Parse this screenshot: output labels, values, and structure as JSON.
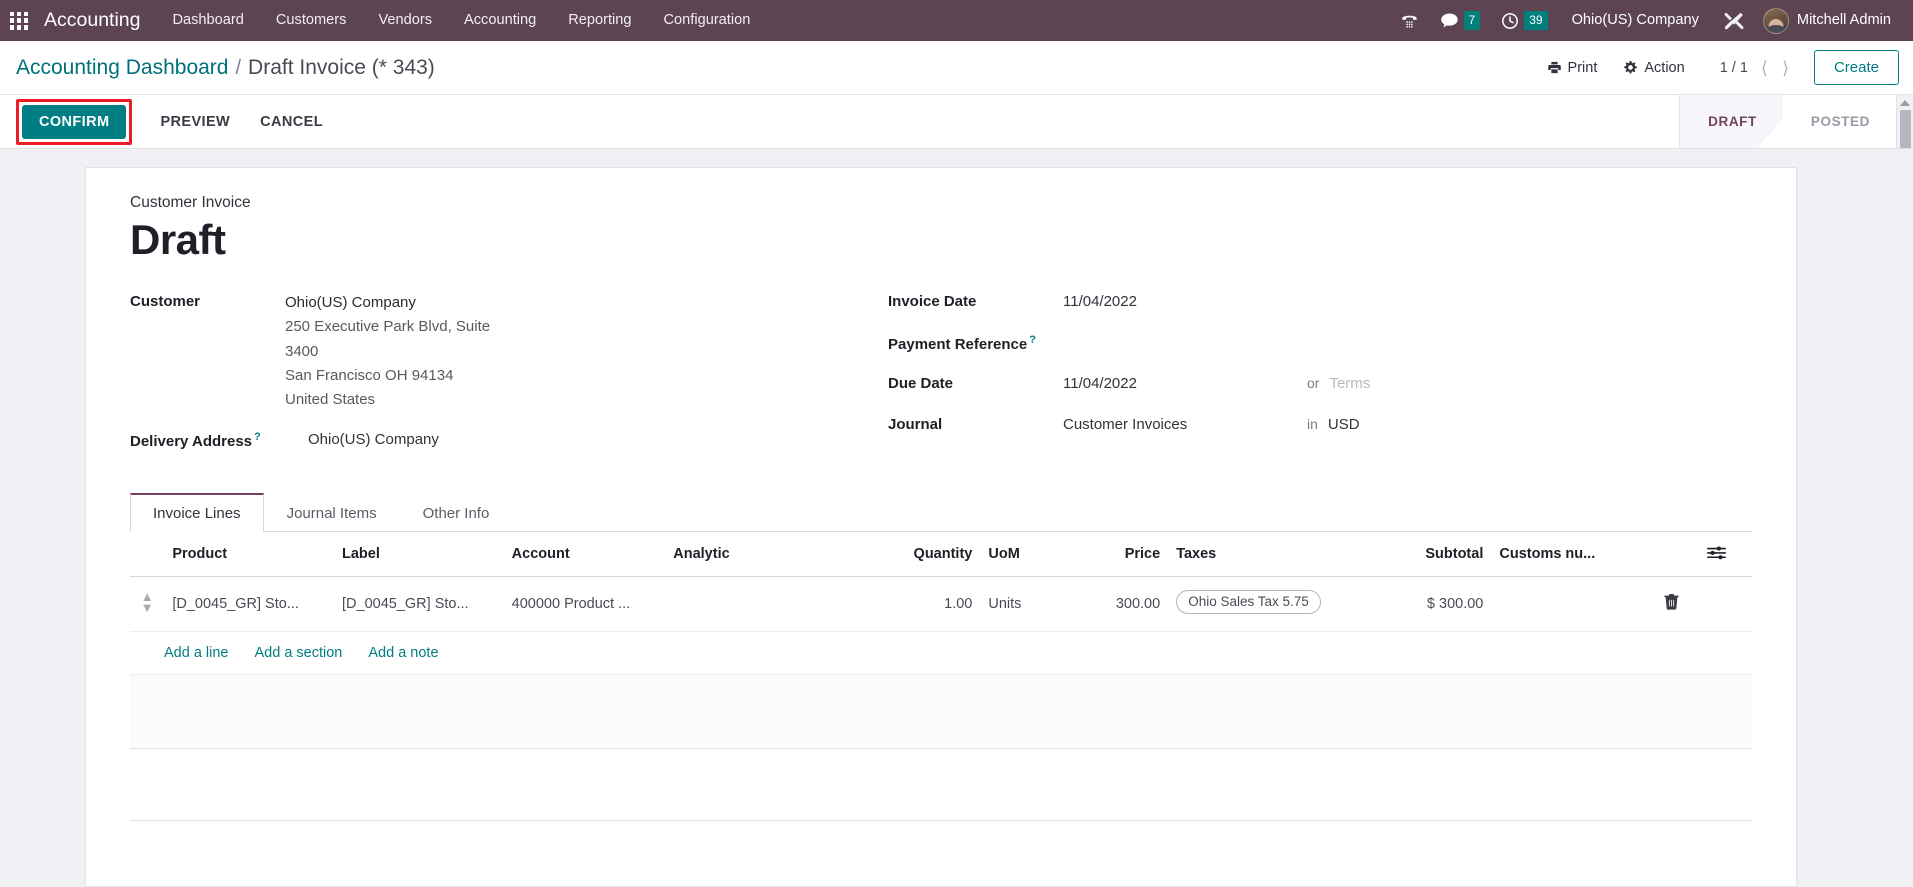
{
  "navbar": {
    "apps_icon": "apps-grid-icon",
    "brand": "Accounting",
    "menu": [
      {
        "label": "Dashboard"
      },
      {
        "label": "Customers"
      },
      {
        "label": "Vendors"
      },
      {
        "label": "Accounting"
      },
      {
        "label": "Reporting"
      },
      {
        "label": "Configuration"
      }
    ],
    "systray": {
      "voip_icon": "phone-dialpad-icon",
      "messages_icon": "chat-bubble-icon",
      "messages_count": "7",
      "activities_icon": "clock-icon",
      "activities_count": "39",
      "company": "Ohio(US) Company",
      "debug_icon": "tools-icon",
      "avatar": "user-avatar",
      "user": "Mitchell Admin"
    },
    "background_color": "#5c4452",
    "badge_color": "#00807b"
  },
  "control_panel": {
    "breadcrumb": {
      "root": "Accounting Dashboard",
      "separator": "/",
      "current": "Draft Invoice (* 343)"
    },
    "print_label": "Print",
    "print_icon": "printer-icon",
    "action_label": "Action",
    "action_icon": "gear-icon",
    "pager": "1 / 1",
    "prev_icon": "chevron-left-icon",
    "next_icon": "chevron-right-icon",
    "create_label": "Create",
    "buttons": {
      "confirm": "CONFIRM",
      "preview": "PREVIEW",
      "cancel": "CANCEL"
    },
    "highlight_color": "#ee1c24",
    "accent_color": "#017e84",
    "statusbar": [
      {
        "label": "DRAFT",
        "active": true
      },
      {
        "label": "POSTED",
        "active": false
      }
    ]
  },
  "form": {
    "doc_type": "Customer Invoice",
    "title": "Draft",
    "left": {
      "customer_label": "Customer",
      "customer_name": "Ohio(US) Company",
      "customer_address": [
        "250 Executive Park Blvd, Suite",
        "3400",
        "San Francisco OH 94134",
        "United States"
      ],
      "delivery_address_label": "Delivery Address",
      "delivery_address_tip": "?",
      "delivery_address_value": "Ohio(US) Company"
    },
    "right": {
      "invoice_date_label": "Invoice Date",
      "invoice_date_value": "11/04/2022",
      "payment_reference_label": "Payment Reference",
      "payment_reference_tip": "?",
      "payment_reference_value": "",
      "due_date_label": "Due Date",
      "due_date_value": "11/04/2022",
      "due_date_or": "or",
      "terms_placeholder": "Terms",
      "journal_label": "Journal",
      "journal_value": "Customer Invoices",
      "journal_in": "in",
      "currency": "USD"
    }
  },
  "notebook": {
    "tabs": [
      {
        "label": "Invoice Lines",
        "active": true
      },
      {
        "label": "Journal Items",
        "active": false
      },
      {
        "label": "Other Info",
        "active": false
      }
    ]
  },
  "lines_table": {
    "columns": [
      "Product",
      "Label",
      "Account",
      "Analytic",
      "Quantity",
      "UoM",
      "Price",
      "Taxes",
      "Subtotal",
      "Customs nu..."
    ],
    "optional_columns_icon": "sliders-icon",
    "rows": [
      {
        "handle_icon": "drag-handle-icon",
        "product": "[D_0045_GR] Sto...",
        "label": "[D_0045_GR] Sto...",
        "account": "400000 Product ...",
        "analytic": "",
        "quantity": "1.00",
        "uom": "Units",
        "price": "300.00",
        "taxes": "Ohio Sales Tax 5.75",
        "subtotal": "$ 300.00",
        "customs_number": "",
        "delete_icon": "trash-icon"
      }
    ],
    "add_links": [
      {
        "label": "Add a line"
      },
      {
        "label": "Add a section"
      },
      {
        "label": "Add a note"
      }
    ]
  }
}
